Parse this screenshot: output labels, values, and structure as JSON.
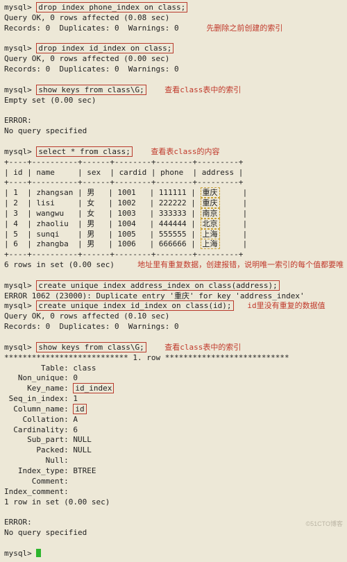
{
  "prompt": "mysql>",
  "blk1": {
    "cmd": "drop index phone_index on class;",
    "r1": "Query OK, 0 rows affected (0.08 sec)",
    "r2": "Records: 0  Duplicates: 0  Warnings: 0",
    "annot": "先删除之前创建的索引"
  },
  "blk2": {
    "cmd": "drop index id_index on class;",
    "r1": "Query OK, 0 rows affected (0.00 sec)",
    "r2": "Records: 0  Duplicates: 0  Warnings: 0"
  },
  "blk3": {
    "cmd": "show keys from class\\G;",
    "annot": "查看class表中的索引",
    "r1": "Empty set (0.00 sec)"
  },
  "err": {
    "l1": "ERROR:",
    "l2": "No query specified"
  },
  "blk4": {
    "cmd": "select * from class;",
    "annot": "查看表class的内容",
    "border": "+----+----------+------+--------+--------+---------+",
    "head": "| id | name     | sex  | cardid | phone  | address |",
    "rows": [
      {
        "txt": "| 1  | zhangsan | 男   | 1001   | 111111 | ",
        "addr": "重庆",
        "tail": "     |"
      },
      {
        "txt": "| 2  | lisi     | 女   | 1002   | 222222 | ",
        "addr": "重庆",
        "tail": "     |"
      },
      {
        "txt": "| 3  | wangwu   | 女   | 1003   | 333333 | ",
        "addr": "南京",
        "tail": "     |"
      },
      {
        "txt": "| 4  | zhaoliu  | 男   | 1004   | 444444 | ",
        "addr": "北京",
        "tail": "     |"
      },
      {
        "txt": "| 5  | sunqi    | 男   | 1005   | 555555 | ",
        "addr": "上海",
        "tail": "     |"
      },
      {
        "txt": "| 6  | zhangba  | 男   | 1006   | 666666 | ",
        "addr": "上海",
        "tail": "     |"
      }
    ],
    "foot": "6 rows in set (0.00 sec)",
    "annot2": "地址里有重复数据，创建报错，说明唯一索引的每个值都要唯"
  },
  "blk5": {
    "cmd": "create unique index address_index on class(address);",
    "r1": "ERROR 1062 (23000): Duplicate entry '重庆' for key 'address_index'"
  },
  "blk6": {
    "cmd": "create unique index id_index on class(id);",
    "annot": "id里没有重复的数据值",
    "r1": "Query OK, 0 rows affected (0.10 sec)",
    "r2": "Records: 0  Duplicates: 0  Warnings: 0"
  },
  "blk7": {
    "cmd": "show keys from class\\G;",
    "annot": "查看class表中的索引",
    "starline": "*************************** 1. row ***************************",
    "fields": {
      "Table": "class",
      "Non_unique": "0",
      "Key_name": "id_index",
      "Seq_in_index": "1",
      "Column_name": "id",
      "Collation": "A",
      "Cardinality": "6",
      "Sub_part": "NULL",
      "Packed": "NULL",
      "Null": "",
      "Index_type": "BTREE",
      "Comment": "",
      "Index_comment": ""
    },
    "foot": "1 row in set (0.00 sec)"
  },
  "watermark": "©51CTO博客"
}
